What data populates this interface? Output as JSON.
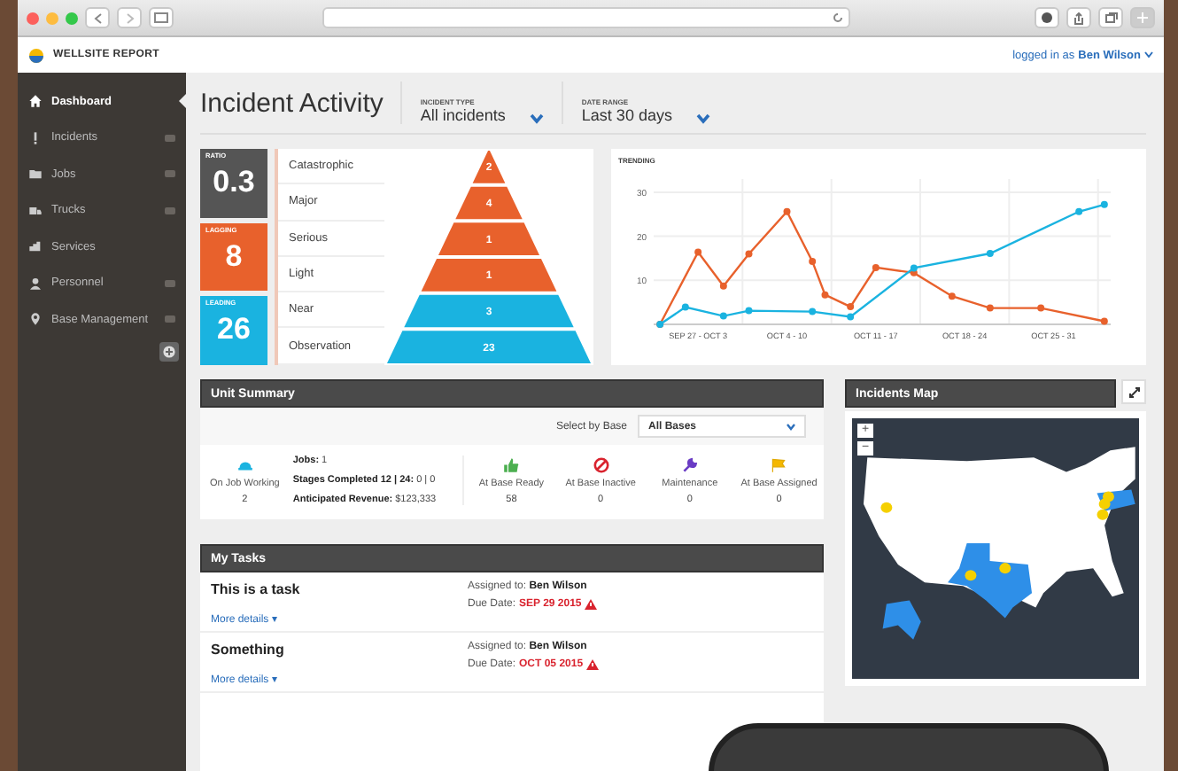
{
  "app": {
    "brand": "WELLSITE REPORT",
    "user_prefix": "logged in as",
    "user": "Ben Wilson"
  },
  "sidebar": {
    "items": [
      {
        "label": "Dashboard",
        "selected": true,
        "badge": false
      },
      {
        "label": "Incidents",
        "selected": false,
        "badge": true
      },
      {
        "label": "Jobs",
        "selected": false,
        "badge": true
      },
      {
        "label": "Trucks",
        "selected": false,
        "badge": true
      },
      {
        "label": "Services",
        "selected": false,
        "badge": false
      },
      {
        "label": "Personnel",
        "selected": false,
        "badge": true
      },
      {
        "label": "Base Management",
        "selected": false,
        "badge": true
      }
    ]
  },
  "header": {
    "title": "Incident Activity",
    "filters": [
      {
        "label": "INCIDENT TYPE",
        "value": "All incidents"
      },
      {
        "label": "DATE RANGE",
        "value": "Last 30 days"
      }
    ]
  },
  "pyramid": {
    "stats": [
      {
        "label": "RATIO",
        "value": "0.3",
        "color": "#555555"
      },
      {
        "label": "LAGGING",
        "value": "8",
        "color": "#e8612c"
      },
      {
        "label": "LEADING",
        "value": "26",
        "color": "#1ab3e0"
      }
    ],
    "levels": [
      {
        "label": "Catastrophic",
        "value": "2",
        "color": "#e8612c"
      },
      {
        "label": "Major",
        "value": "4",
        "color": "#e8612c"
      },
      {
        "label": "Serious",
        "value": "1",
        "color": "#e8612c"
      },
      {
        "label": "Light",
        "value": "1",
        "color": "#e8612c"
      },
      {
        "label": "Near",
        "value": "3",
        "color": "#1ab3e0"
      },
      {
        "label": "Observation",
        "value": "23",
        "color": "#1ab3e0"
      }
    ]
  },
  "trending": {
    "chart_data": {
      "type": "line",
      "title": "TRENDING",
      "grid": true,
      "ylim": [
        0,
        33
      ],
      "yticks": [
        10,
        20,
        30
      ],
      "categories": [
        null,
        null,
        null,
        "SEP 27 - OCT 3",
        null,
        null,
        null,
        null,
        null,
        null,
        "OCT 4 - 10",
        null,
        null,
        null,
        null,
        null,
        null,
        "OCT 11 - 17",
        null,
        null,
        null,
        null,
        null,
        null,
        "OCT 18 - 24",
        null,
        null,
        null,
        null,
        null,
        null,
        "OCT 25 - 31",
        null,
        null,
        null,
        null
      ],
      "series": [
        {
          "color": "#e8612c",
          "marker": "circle",
          "values": [
            0,
            null,
            null,
            16.4,
            null,
            8.7,
            null,
            16,
            null,
            null,
            25.6,
            null,
            14.3,
            6.7,
            null,
            4,
            null,
            12.9,
            null,
            null,
            11.7,
            null,
            null,
            6.4,
            null,
            null,
            3.7,
            null,
            null,
            null,
            3.7,
            null,
            null,
            null,
            null,
            0.7
          ]
        },
        {
          "color": "#1ab3e0",
          "marker": "circle",
          "values": [
            0,
            null,
            3.9,
            null,
            null,
            1.9,
            null,
            3.1,
            null,
            null,
            null,
            null,
            2.9,
            null,
            null,
            1.7,
            null,
            null,
            null,
            null,
            12.8,
            null,
            null,
            null,
            null,
            null,
            16.1,
            null,
            null,
            null,
            null,
            null,
            null,
            25.6,
            null,
            27.2
          ]
        }
      ]
    }
  },
  "unit_summary": {
    "title": "Unit Summary",
    "select_label": "Select by Base",
    "select_value": "All Bases",
    "working": {
      "label": "On Job Working",
      "value": "2"
    },
    "details": [
      "**Jobs:** 1",
      "**Stages Completed 12 | 24:** 0 | 0",
      "**Anticipated Revenue:** $123,333"
    ],
    "units": [
      {
        "kind": "ready",
        "label": "At Base Ready",
        "value": "58"
      },
      {
        "kind": "inactive",
        "label": "At Base Inactive",
        "value": "0"
      },
      {
        "kind": "maintenance",
        "label": "Maintenance",
        "value": "0"
      },
      {
        "kind": "assigned",
        "label": "At Base Assigned",
        "value": "0"
      }
    ]
  },
  "map": {
    "title": "Incidents Map",
    "zoom_in": "+",
    "zoom_out": "−"
  },
  "tasks": {
    "title": "My Tasks",
    "items": [
      {
        "name": "This is a task",
        "assigned": "Assigned to: **Ben Wilson**",
        "due_label": "Due Date:",
        "due": "SEP 29 2015",
        "overdue": true,
        "more": "More details ▾"
      },
      {
        "name": "Something",
        "assigned": "Assigned to: **Ben Wilson**",
        "due_label": "Due Date:",
        "due": "OCT 05 2015",
        "overdue": true,
        "more": "More details ▾"
      }
    ]
  }
}
